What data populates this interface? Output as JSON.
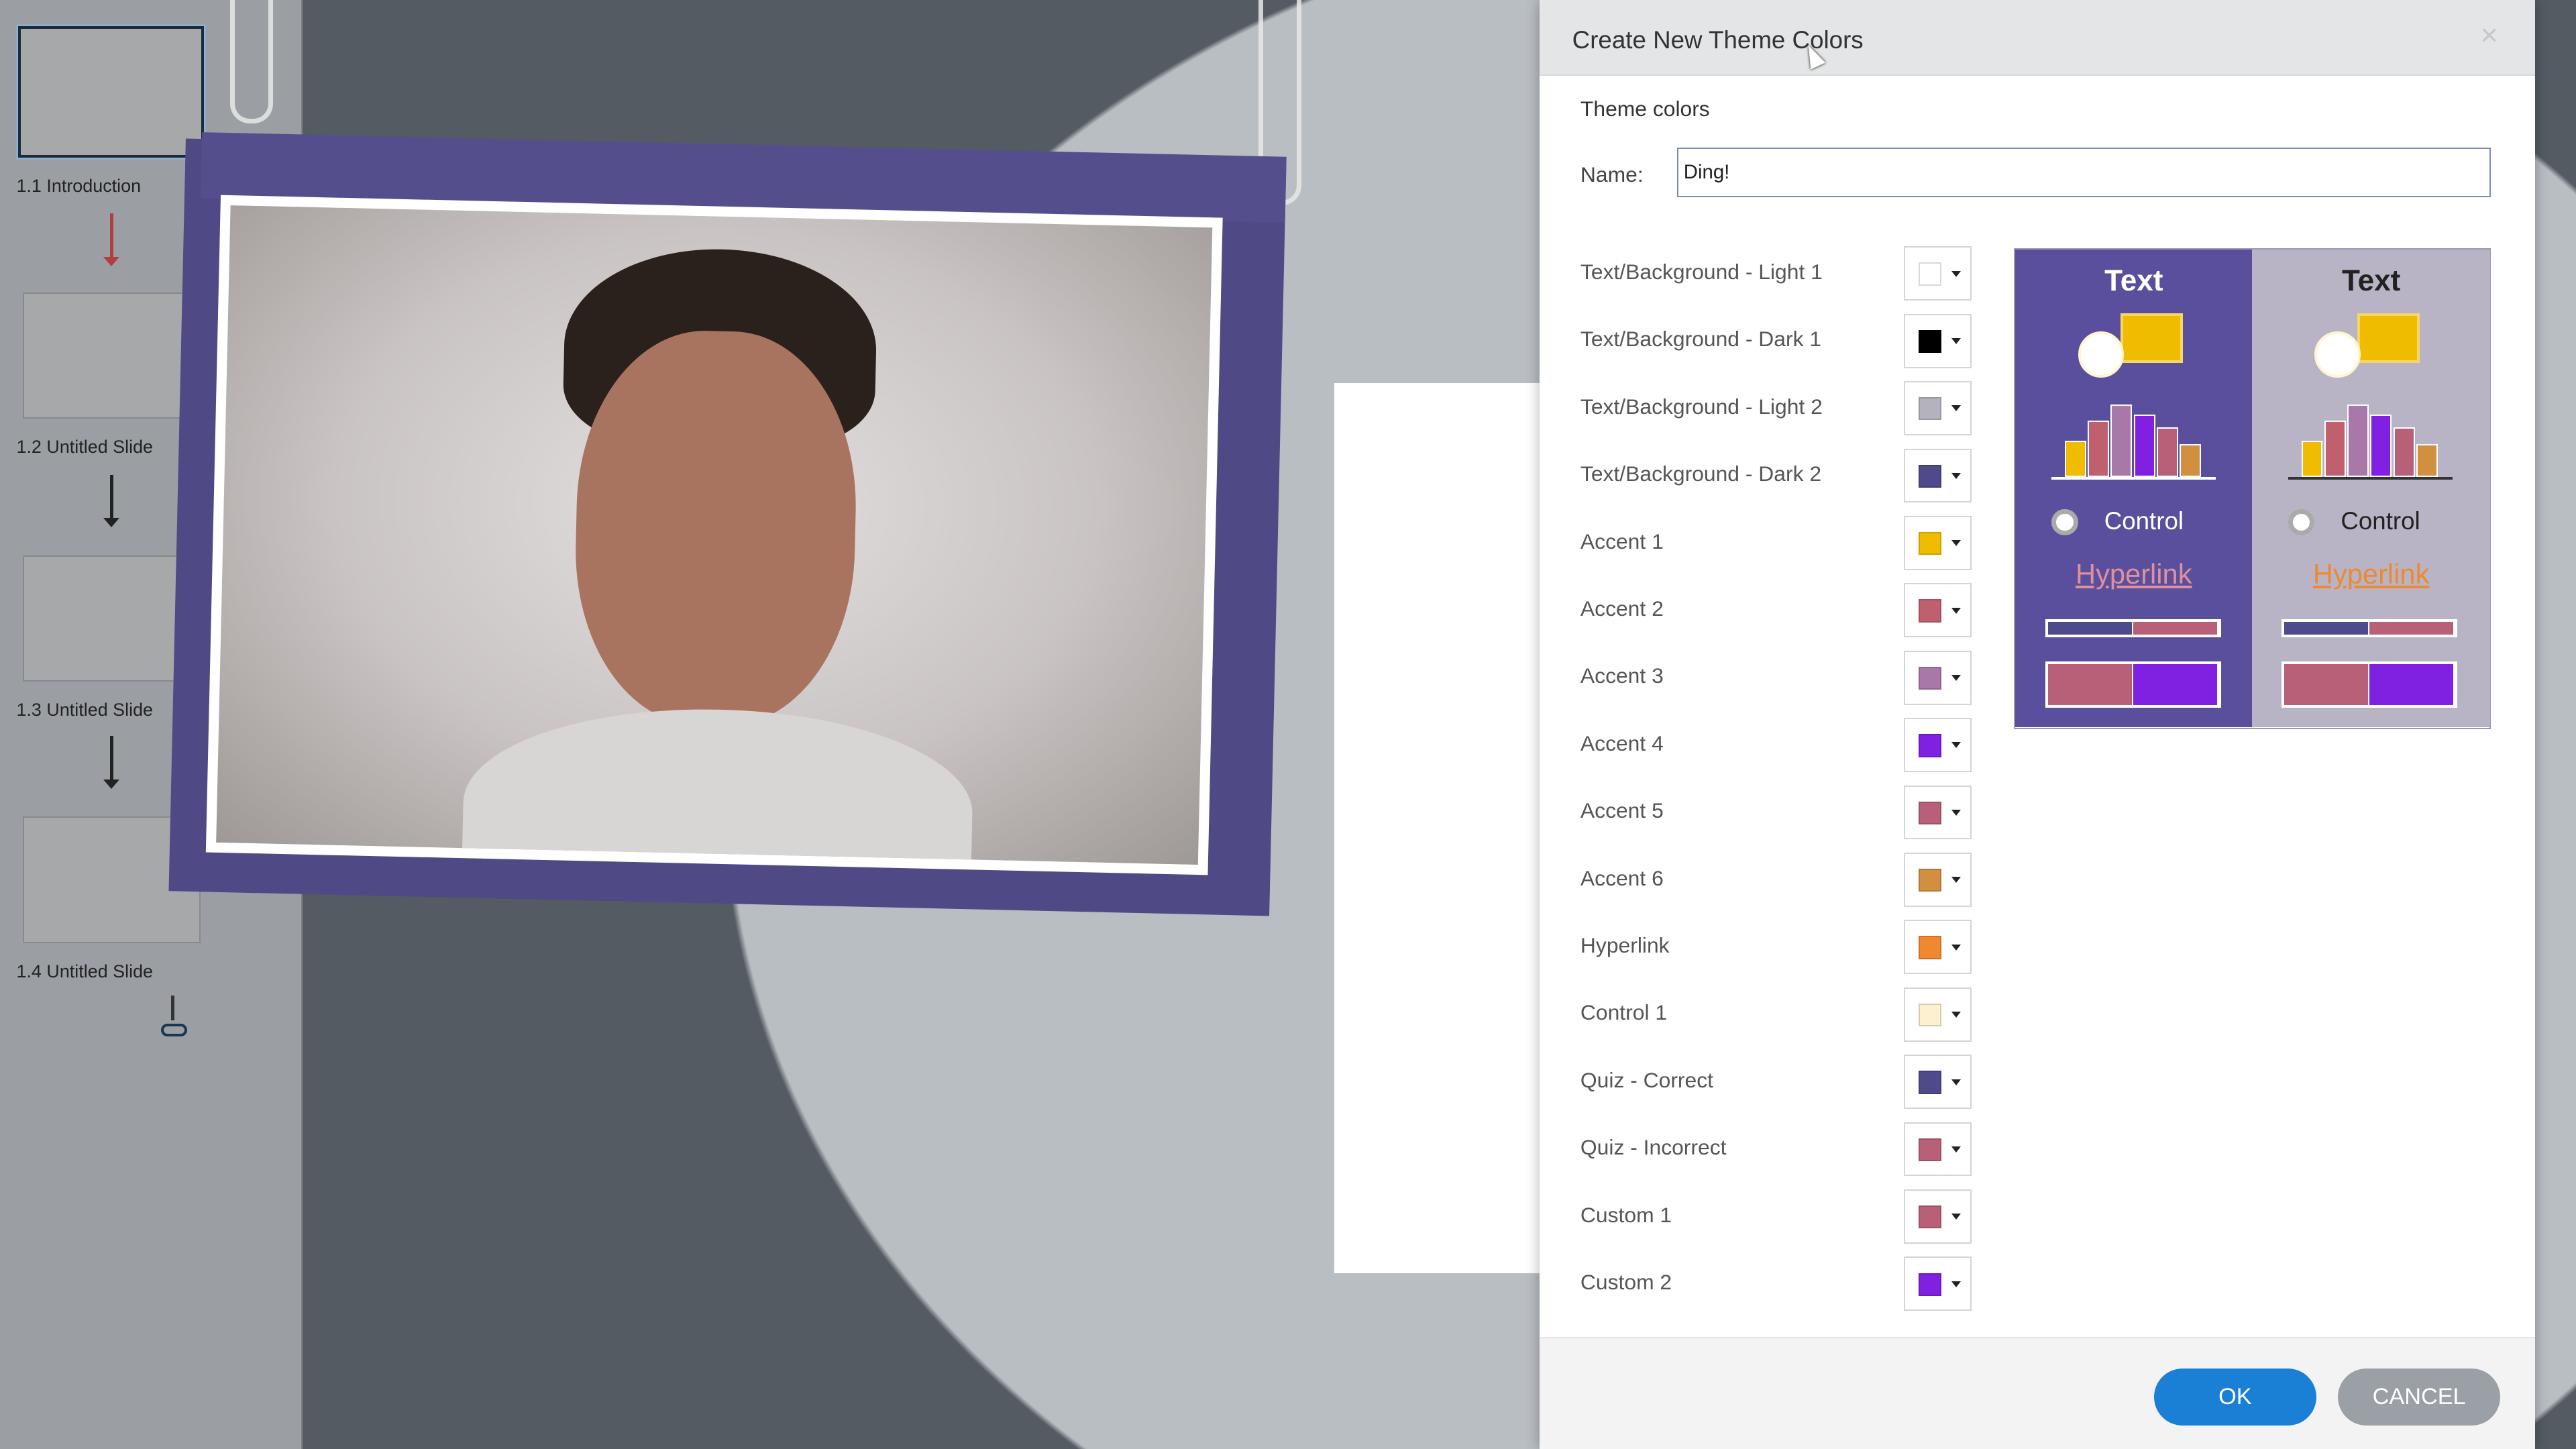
{
  "slides": [
    {
      "label": "1.1 Introduction",
      "selected": true
    },
    {
      "label": "1.2 Untitled Slide"
    },
    {
      "label": "1.3 Untitled Slide"
    },
    {
      "label": "1.4 Untitled Slide"
    }
  ],
  "dialog": {
    "title": "Create New Theme Colors",
    "close_icon": "close-icon",
    "section": "Theme colors",
    "name_label": "Name:",
    "name_value": "Ding!",
    "colors": [
      {
        "label": "Text/Background - Light 1",
        "color": "#ffffff"
      },
      {
        "label": "Text/Background - Dark 1",
        "color": "#000000"
      },
      {
        "label": "Text/Background - Light 2",
        "color": "#b4b2bc"
      },
      {
        "label": "Text/Background - Dark 2",
        "color": "#4e4a8c"
      },
      {
        "label": "Accent 1",
        "color": "#f0bc00"
      },
      {
        "label": "Accent 2",
        "color": "#c0606e"
      },
      {
        "label": "Accent 3",
        "color": "#a878a8"
      },
      {
        "label": "Accent 4",
        "color": "#8020e0"
      },
      {
        "label": "Accent 5",
        "color": "#b86078"
      },
      {
        "label": "Accent 6",
        "color": "#d09040"
      },
      {
        "label": "Hyperlink",
        "color": "#f08830"
      },
      {
        "label": "Control 1",
        "color": "#fcf0d0"
      },
      {
        "label": "Quiz - Correct",
        "color": "#4e4a8c"
      },
      {
        "label": "Quiz - Incorrect",
        "color": "#b86078"
      },
      {
        "label": "Custom 1",
        "color": "#b86078"
      },
      {
        "label": "Custom 2",
        "color": "#8020e0"
      }
    ],
    "preview": {
      "dark": {
        "text": "Text",
        "control": "Control",
        "hyperlink": "Hyperlink",
        "bg": "#5a4f9c",
        "fg": "#ffffff"
      },
      "light": {
        "text": "Text",
        "control": "Control",
        "hyperlink": "Hyperlink",
        "bg": "#b8b4c6",
        "fg": "#222222"
      }
    },
    "ok_label": "OK",
    "cancel_label": "CANCEL"
  }
}
